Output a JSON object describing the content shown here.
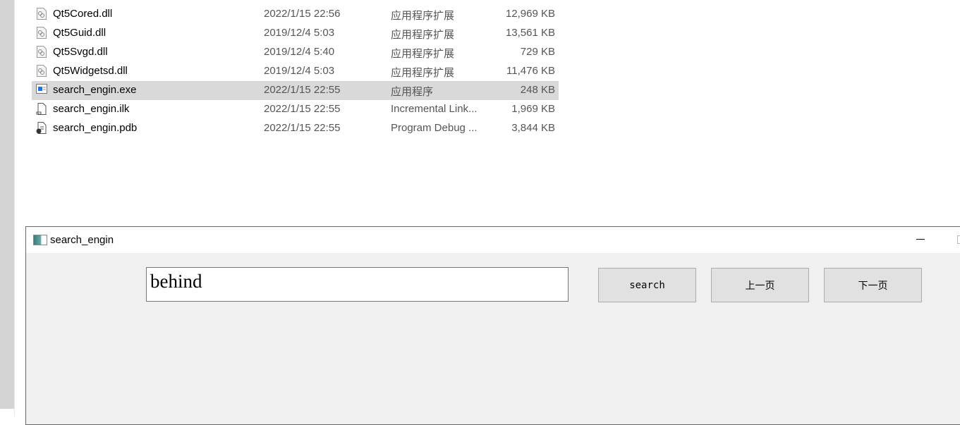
{
  "files": [
    {
      "name": "Qt5Cored.dll",
      "date": "2022/1/15 22:56",
      "type": "应用程序扩展",
      "size": "12,969 KB",
      "icon": "dll-icon"
    },
    {
      "name": "Qt5Guid.dll",
      "date": "2019/12/4 5:03",
      "type": "应用程序扩展",
      "size": "13,561 KB",
      "icon": "dll-icon"
    },
    {
      "name": "Qt5Svgd.dll",
      "date": "2019/12/4 5:40",
      "type": "应用程序扩展",
      "size": "729 KB",
      "icon": "dll-icon"
    },
    {
      "name": "Qt5Widgetsd.dll",
      "date": "2019/12/4 5:03",
      "type": "应用程序扩展",
      "size": "11,476 KB",
      "icon": "dll-icon"
    },
    {
      "name": "search_engin.exe",
      "date": "2022/1/15 22:55",
      "type": "应用程序",
      "size": "248 KB",
      "icon": "exe-icon",
      "selected": true
    },
    {
      "name": "search_engin.ilk",
      "date": "2022/1/15 22:55",
      "type": "Incremental Link...",
      "size": "1,969 KB",
      "icon": "ilk-icon"
    },
    {
      "name": "search_engin.pdb",
      "date": "2022/1/15 22:55",
      "type": "Program Debug ...",
      "size": "3,844 KB",
      "icon": "pdb-icon"
    }
  ],
  "window": {
    "title": "search_engin",
    "query": "behind",
    "search_label": "search",
    "prev_label": "上一页",
    "next_label": "下一页"
  }
}
